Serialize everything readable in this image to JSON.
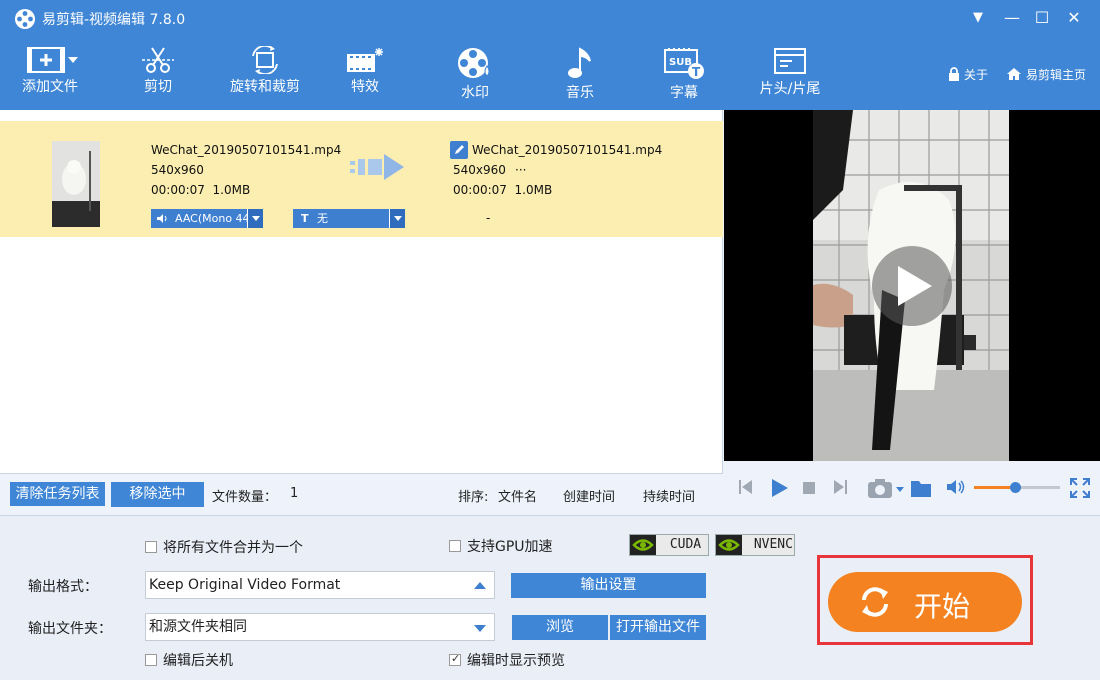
{
  "app": {
    "title": "易剪辑-视频编辑 7.8.0",
    "window_controls": [
      "▼",
      "—",
      "☐",
      "✕"
    ]
  },
  "toolbar": {
    "items": [
      {
        "label": "添加文件",
        "icon": "add-file-icon"
      },
      {
        "label": "剪切",
        "icon": "scissors-icon"
      },
      {
        "label": "旋转和裁剪",
        "icon": "rotate-crop-icon"
      },
      {
        "label": "特效",
        "icon": "effects-icon"
      },
      {
        "label": "水印",
        "icon": "watermark-icon"
      },
      {
        "label": "音乐",
        "icon": "music-note-icon"
      },
      {
        "label": "字幕",
        "icon": "subtitle-icon"
      },
      {
        "label": "片头/片尾",
        "icon": "intro-outro-icon"
      }
    ],
    "about_label": "关于",
    "home_label": "易剪辑主页"
  },
  "task": {
    "source": {
      "filename": "WeChat_20190507101541.mp4",
      "resolution": "540x960",
      "duration_size": "00:00:07  1.0MB"
    },
    "output": {
      "filename": "WeChat_20190507101541.mp4",
      "resolution": "540x960",
      "resolution_extra": "···",
      "duration_size": "00:00:07  1.0MB"
    },
    "audio_track": "AAC(Mono 44",
    "subtitle_track": "无",
    "dash": "-"
  },
  "task_footer": {
    "clear_label": "清除任务列表",
    "remove_label": "移除选中",
    "file_count_label": "文件数量：",
    "file_count": "1",
    "sort_label": "排序:",
    "sort_options": [
      "文件名",
      "创建时间",
      "持续时间"
    ]
  },
  "player": {
    "volume_level": 0.48
  },
  "settings": {
    "merge_label": "将所有文件合并为一个",
    "merge_checked": false,
    "gpu_label": "支持GPU加速",
    "gpu_checked": false,
    "cuda_label": "CUDA",
    "nvenc_label": "NVENC",
    "format_label": "输出格式：",
    "format_value": "Keep Original Video Format",
    "output_settings_label": "输出设置",
    "folder_label": "输出文件夹：",
    "folder_value": "和源文件夹相同",
    "browse_label": "浏览",
    "open_folder_label": "打开输出文件",
    "shutdown_label": "编辑后关机",
    "shutdown_checked": false,
    "preview_label": "编辑时显示预览",
    "preview_checked": true
  },
  "start": {
    "label": "开始"
  },
  "colors": {
    "header": "#3f86d6",
    "row_highlight": "#fbeeb0",
    "start": "#f58220",
    "highlight_frame": "#e8353a"
  }
}
